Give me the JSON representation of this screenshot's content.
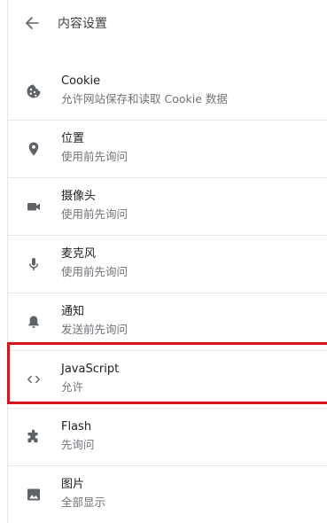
{
  "header": {
    "title": "内容设置"
  },
  "items": [
    {
      "id": "cookie",
      "icon": "cookie-icon",
      "title": "Cookie",
      "subtitle": "允许网站保存和读取 Cookie 数据"
    },
    {
      "id": "location",
      "icon": "location-pin-icon",
      "title": "位置",
      "subtitle": "使用前先询问"
    },
    {
      "id": "camera",
      "icon": "camera-icon",
      "title": "摄像头",
      "subtitle": "使用前先询问"
    },
    {
      "id": "microphone",
      "icon": "microphone-icon",
      "title": "麦克风",
      "subtitle": "使用前先询问"
    },
    {
      "id": "notifications",
      "icon": "bell-icon",
      "title": "通知",
      "subtitle": "发送前先询问"
    },
    {
      "id": "javascript",
      "icon": "code-icon",
      "title": "JavaScript",
      "subtitle": "允许"
    },
    {
      "id": "flash",
      "icon": "puzzle-piece-icon",
      "title": "Flash",
      "subtitle": "先询问"
    },
    {
      "id": "images",
      "icon": "image-icon",
      "title": "图片",
      "subtitle": "全部显示"
    }
  ],
  "colors": {
    "icon": "#5f6368",
    "title_text": "#202124",
    "subtitle_text": "#6f7378",
    "highlight_border": "#d6141b",
    "divider": "#e8e8e8"
  }
}
